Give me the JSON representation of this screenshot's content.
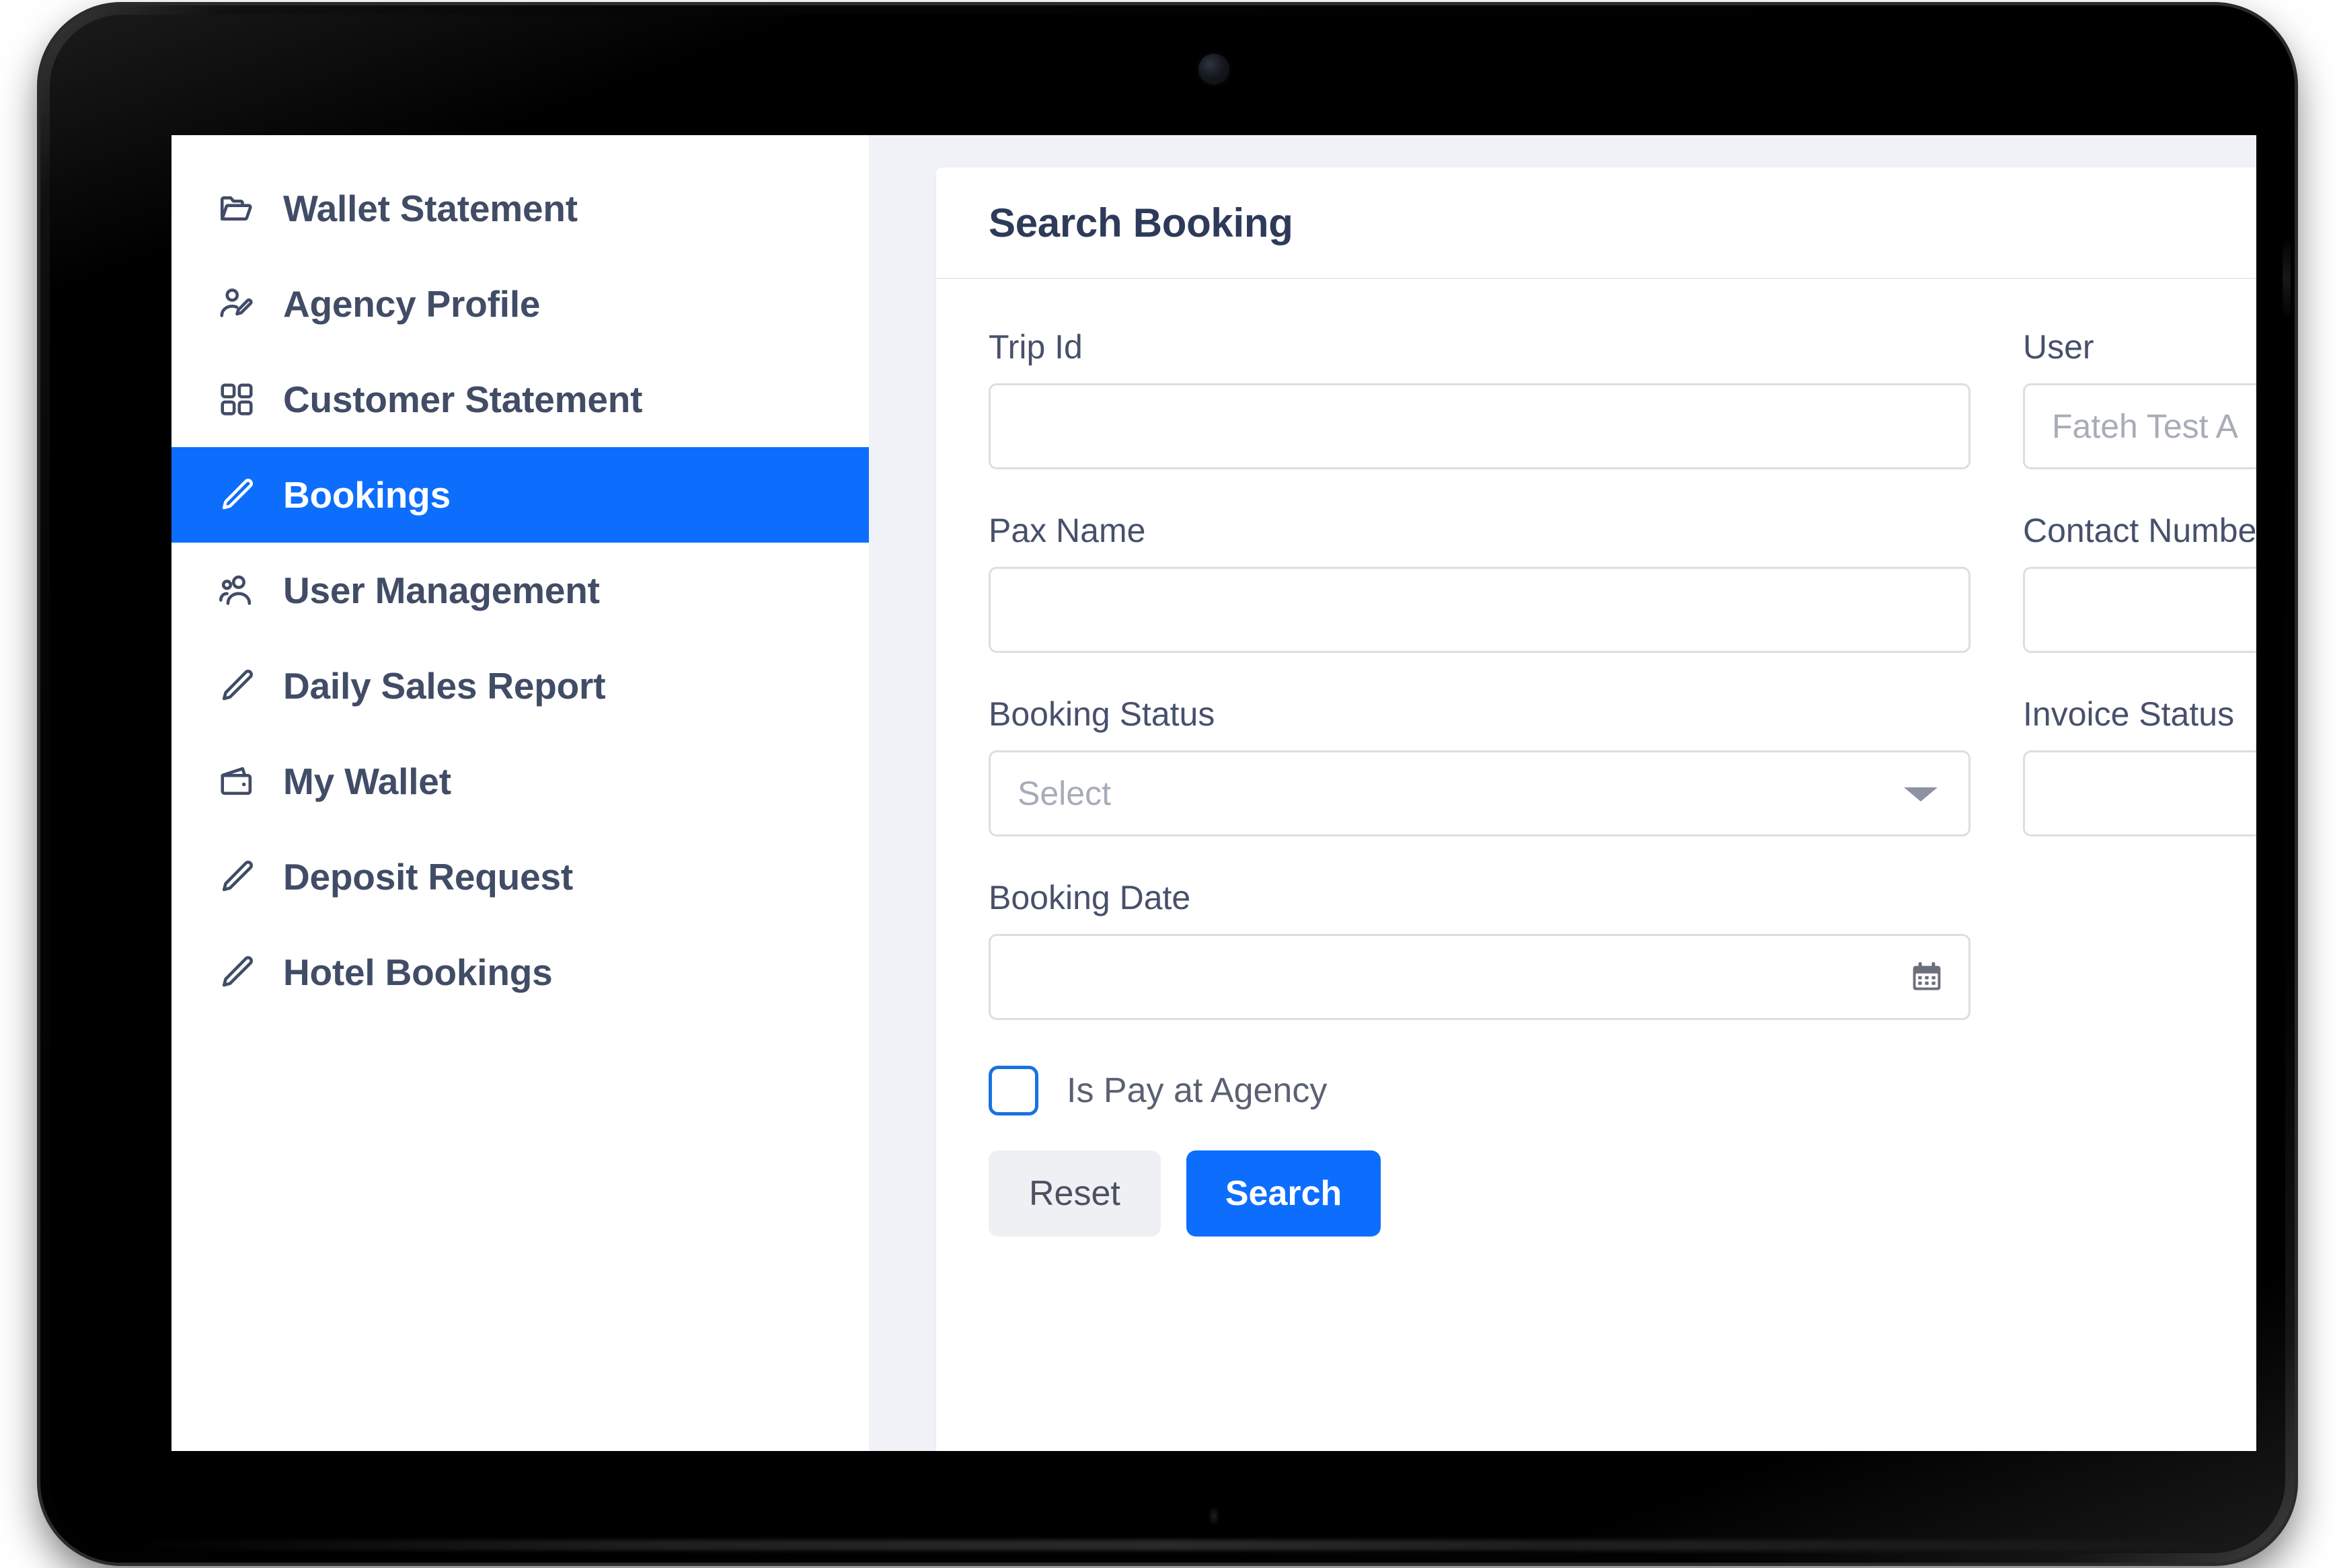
{
  "theme": {
    "accent": "#0d6efd",
    "sidebar_bg": "#ffffff",
    "sidebar_text": "#414c66",
    "page_bg": "#f1f2f7",
    "card_bg": "#ffffff",
    "label_text": "#47506b",
    "placeholder_text": "#a8acb8",
    "field_border": "#dcdee4",
    "checkbox_border": "#1773e0",
    "reset_bg": "#eff0f4"
  },
  "sidebar": {
    "items": [
      {
        "label": "Wallet Statement",
        "icon": "folder-open-icon",
        "active": false
      },
      {
        "label": "Agency Profile",
        "icon": "user-edit-icon",
        "active": false
      },
      {
        "label": "Customer Statement",
        "icon": "grid-icon",
        "active": false
      },
      {
        "label": "Bookings",
        "icon": "pencil-icon",
        "active": true
      },
      {
        "label": "User Management",
        "icon": "users-icon",
        "active": false
      },
      {
        "label": "Daily Sales Report",
        "icon": "pencil-icon",
        "active": false
      },
      {
        "label": "My Wallet",
        "icon": "wallet-icon",
        "active": false
      },
      {
        "label": "Deposit Request",
        "icon": "pencil-icon",
        "active": false
      },
      {
        "label": "Hotel Bookings",
        "icon": "pencil-icon",
        "active": false
      }
    ]
  },
  "card": {
    "title": "Search Booking",
    "fields": {
      "trip_id": {
        "label": "Trip Id",
        "value": "",
        "placeholder": ""
      },
      "user": {
        "label": "User",
        "value": "Fateh Test A",
        "placeholder": ""
      },
      "pax_name": {
        "label": "Pax Name",
        "value": "",
        "placeholder": ""
      },
      "contact_number": {
        "label": "Contact Number",
        "value": "",
        "placeholder": ""
      },
      "booking_status": {
        "label": "Booking Status",
        "value": "",
        "placeholder": "Select"
      },
      "invoice_status": {
        "label": "Invoice Status",
        "value": "",
        "placeholder": ""
      },
      "booking_date": {
        "label": "Booking Date",
        "value": "",
        "placeholder": ""
      }
    },
    "checkbox": {
      "label": "Is Pay at Agency",
      "checked": false
    },
    "buttons": {
      "reset": "Reset",
      "search": "Search"
    }
  }
}
